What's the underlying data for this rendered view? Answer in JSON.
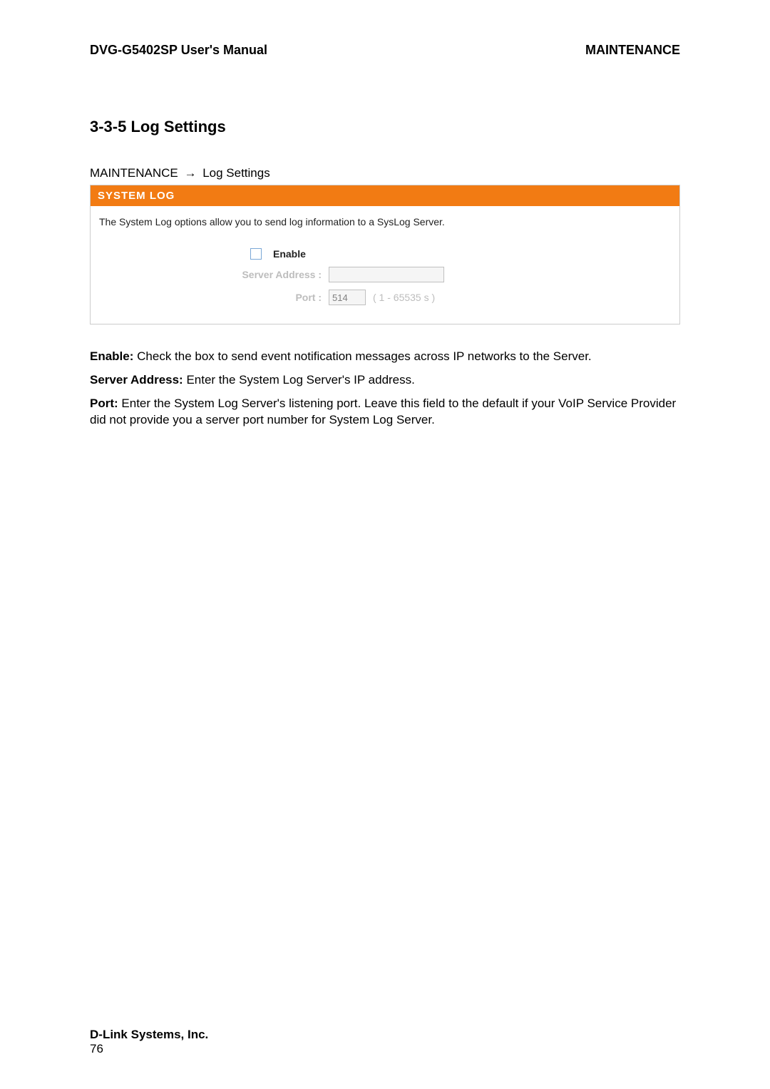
{
  "header": {
    "left": "DVG-G5402SP User's Manual",
    "right": "MAINTENANCE"
  },
  "section_title": "3-3-5 Log Settings",
  "breadcrumb": {
    "parent": "MAINTENANCE",
    "arrow": "→",
    "current": "Log Settings"
  },
  "panel": {
    "title": "SYSTEM LOG",
    "description": "The System Log options allow you to send log information to a SysLog Server.",
    "labels": {
      "enable": "Enable",
      "server_address": "Server Address :",
      "port": "Port :"
    },
    "values": {
      "server_address": "",
      "port": "514"
    },
    "hints": {
      "port_range": "( 1 - 65535 s )"
    }
  },
  "explain": {
    "enable_label": "Enable:",
    "enable_text": " Check the box to send event notification messages across IP networks to the Server.",
    "server_label": "Server Address:",
    "server_text": " Enter the System Log Server's IP address.",
    "port_label": "Port:",
    "port_text": " Enter the System Log Server's listening port. Leave this field to the default if your VoIP Service Provider did not provide you a server port number for System Log Server."
  },
  "footer": {
    "company": "D-Link Systems, Inc.",
    "page_number": "76"
  }
}
